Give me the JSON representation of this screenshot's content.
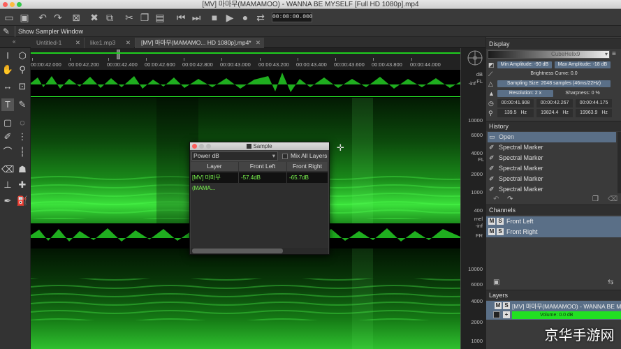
{
  "window": {
    "title": "[MV] 마마무(MAMAMOO) - WANNA BE MYSELF [Full HD 1080p].mp4"
  },
  "toolbar": {
    "timecode": "00:00:00.000"
  },
  "subbar": {
    "show_sampler_label": "Show Sampler Window"
  },
  "tabs": [
    {
      "label": "Untitled-1"
    },
    {
      "label": "like1.mp3"
    },
    {
      "label": "[MV] 마마무(MAMAMO... HD 1080p].mp4*"
    }
  ],
  "ruler": {
    "ticks": [
      "00:00:42.000",
      "00:00:42.200",
      "00:00:42.400",
      "00:00:42.600",
      "00:00:42.800",
      "00:00:43.000",
      "00:00:43.200",
      "00:00:43.400",
      "00:00:43.600",
      "00:00:43.800",
      "00:00:44.000"
    ]
  },
  "scale": {
    "db_label": "dB",
    "fl_top": "FL",
    "inf1": "-inf",
    "hz_labels": [
      "10000",
      "6000",
      "4000",
      "2000",
      "1000",
      "400"
    ],
    "fl_label": "FL",
    "mel": "mel",
    "inf2": "-inf",
    "fr_label": "FR",
    "hz_labels2": [
      "10000",
      "6000",
      "4000",
      "2000",
      "1000"
    ]
  },
  "display": {
    "header": "Display",
    "colormap": "CubeHelix9",
    "min_amp": "Min Amplitude: -90 dB",
    "max_amp": "Max Amplitude: -18 dB",
    "brightness": "Brightness Curve: 0.0",
    "sampling": "Sampling Size: 2048 samples (46ms/22Hz)",
    "resolution": "Resolution: 2 x",
    "sharpness": "Sharpness: 0 %",
    "t_start": "00:00:41.908",
    "t_mid": "00:00:42.267",
    "t_end": "00:00:44.175",
    "f1": "139.5",
    "f1_unit": "Hz",
    "f2": "19824.4",
    "f2_unit": "Hz",
    "f3": "19963.9",
    "f3_unit": "Hz"
  },
  "history": {
    "header": "History",
    "items": [
      "Open",
      "Spectral Marker",
      "Spectral Marker",
      "Spectral Marker",
      "Spectral Marker",
      "Spectral Marker"
    ]
  },
  "channels": {
    "header": "Channels",
    "items": [
      {
        "m": "M",
        "s": "S",
        "label": "Front Left"
      },
      {
        "m": "M",
        "s": "S",
        "label": "Front Right"
      }
    ]
  },
  "layers": {
    "header": "Layers",
    "name": "[MV] 마마무(MAMAMOO) - WANNA BE M",
    "volume": "Volume: 0.0 dB",
    "m": "M",
    "s": "S",
    "plus": "+"
  },
  "sample_dialog": {
    "title": "Sample",
    "mode": "Power dB",
    "mix_all": "Mix All Layers",
    "columns": [
      "Layer",
      "Front Left",
      "Front Right"
    ],
    "row": {
      "layer": "[MV] 마마무(MAMA...",
      "fl": "-57.4dB",
      "fr": "-65.7dB"
    }
  },
  "watermark": "京华手游网"
}
